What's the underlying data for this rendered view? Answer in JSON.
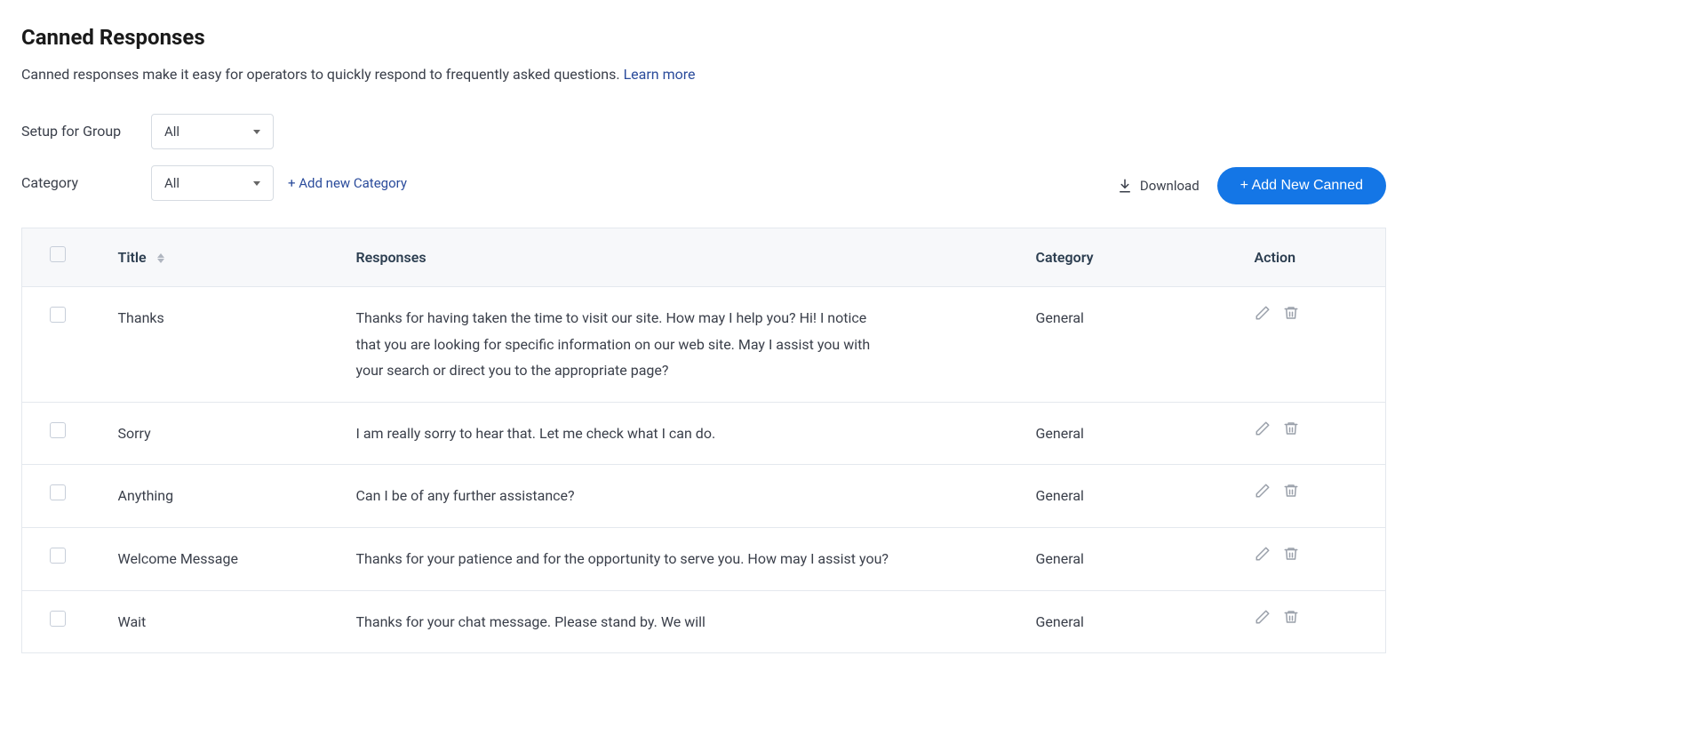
{
  "page": {
    "title": "Canned Responses",
    "desc": "Canned responses make it easy for operators to quickly respond to frequently asked questions. ",
    "learnMore": "Learn more"
  },
  "filters": {
    "groupLabel": "Setup for Group",
    "groupValue": "All",
    "categoryLabel": "Category",
    "categoryValue": "All",
    "addCategory": "+ Add new Category"
  },
  "toolbar": {
    "download": "Download",
    "addNew": "+ Add New Canned"
  },
  "table": {
    "headers": {
      "title": "Title",
      "responses": "Responses",
      "category": "Category",
      "action": "Action"
    },
    "rows": [
      {
        "title": "Thanks",
        "response": "Thanks for having taken the time to visit our site. How may I help you? Hi! I notice that you are looking for specific information on our web site. May I assist you with your search or direct you to the appropriate page?",
        "category": "General"
      },
      {
        "title": "Sorry",
        "response": "I am really sorry to hear that. Let me check what I can do.",
        "category": "General"
      },
      {
        "title": "Anything",
        "response": "Can I be of any further assistance?",
        "category": "General"
      },
      {
        "title": "Welcome Message",
        "response": "Thanks for your patience and for the opportunity to serve you. How may I assist you?",
        "category": "General"
      },
      {
        "title": "Wait",
        "response": "Thanks for your chat message. Please stand by. We will",
        "category": "General",
        "truncated": true
      }
    ]
  }
}
